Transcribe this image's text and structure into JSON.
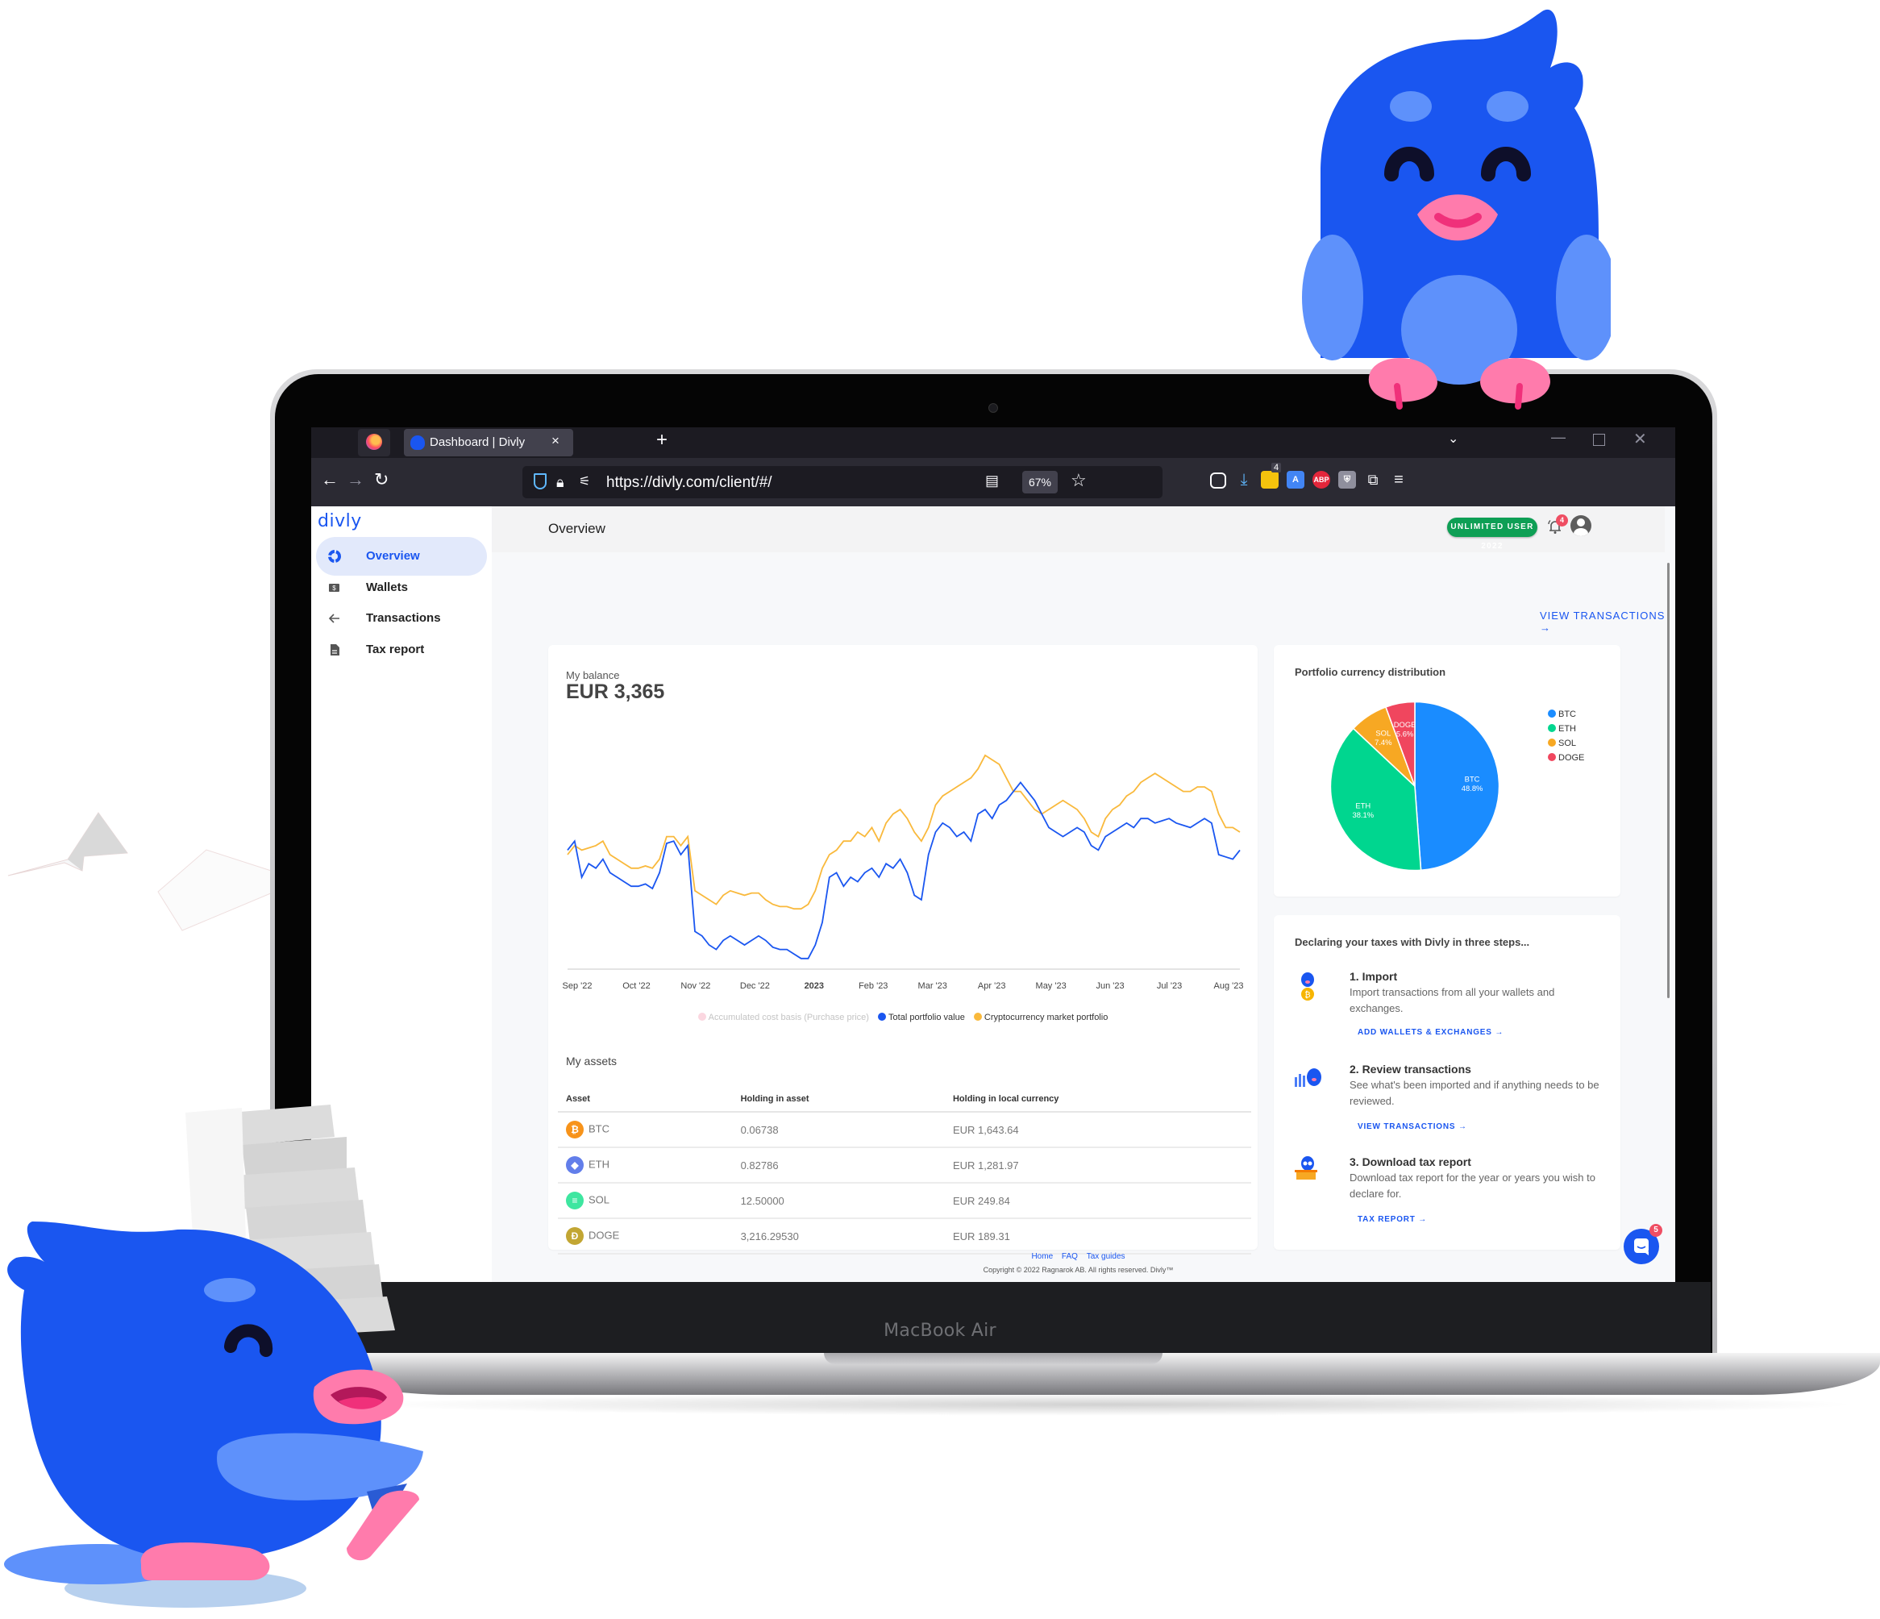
{
  "device": {
    "label": "MacBook Air"
  },
  "browser": {
    "tab_title": "Dashboard | Divly",
    "tab_close": "×",
    "new_tab": "+",
    "list_all_tabs": "⌄",
    "window_controls": {
      "minimize": "—",
      "close": "✕"
    },
    "nav": {
      "back": "←",
      "forward": "→",
      "reload": "↻"
    },
    "url_prefix": "https://",
    "url_domain": "divly.com",
    "url_path": "/client/#/",
    "zoom": "67%",
    "extensions": [
      {
        "name": "pocket",
        "label": "⊙"
      },
      {
        "name": "downloads",
        "label": "⤓"
      },
      {
        "name": "notes-extension",
        "label": "4"
      },
      {
        "name": "translate-extension",
        "label": "A"
      },
      {
        "name": "adblock-plus",
        "label": "ABP"
      },
      {
        "name": "bitwarden",
        "label": "⛨"
      },
      {
        "name": "extensions-puzzle",
        "label": "⧉"
      },
      {
        "name": "menu",
        "label": "≡"
      }
    ],
    "icons": {
      "star": "☆",
      "reader": "▤",
      "lock": "🔒",
      "permissions": "⚟"
    }
  },
  "app": {
    "brand": "divly",
    "sidebar": {
      "items": [
        {
          "label": "Overview",
          "icon": "donut-icon",
          "active": true
        },
        {
          "label": "Wallets",
          "icon": "wallet-icon",
          "active": false
        },
        {
          "label": "Transactions",
          "icon": "arrow-left-icon",
          "active": false
        },
        {
          "label": "Tax report",
          "icon": "document-icon",
          "active": false
        }
      ]
    },
    "header": {
      "title": "Overview",
      "plan_badge": "UNLIMITED USER 2022",
      "notification_count": "4"
    },
    "view_transactions": "VIEW TRANSACTIONS →",
    "balance": {
      "label": "My balance",
      "value": "EUR 3,365"
    },
    "assets": {
      "title": "My assets",
      "columns": [
        "Asset",
        "Holding in asset",
        "Holding in local currency"
      ],
      "rows": [
        {
          "symbol": "BTC",
          "holding": "0.06738",
          "local": "EUR 1,643.64",
          "color": "#f7931a",
          "glyph": "₿"
        },
        {
          "symbol": "ETH",
          "holding": "0.82786",
          "local": "EUR 1,281.97",
          "color": "#627eea",
          "glyph": "◆"
        },
        {
          "symbol": "SOL",
          "holding": "12.50000",
          "local": "EUR 249.84",
          "color": "#3ee6a0",
          "glyph": "≡"
        },
        {
          "symbol": "DOGE",
          "holding": "3,216.29530",
          "local": "EUR 189.31",
          "color": "#c2a633",
          "glyph": "Ð"
        }
      ]
    },
    "pie_title": "Portfolio currency distribution",
    "steps": {
      "title": "Declaring your taxes with Divly in three steps...",
      "items": [
        {
          "heading": "1. Import",
          "desc": "Import transactions from all your wallets and exchanges.",
          "link": "ADD WALLETS & EXCHANGES  →"
        },
        {
          "heading": "2. Review transactions",
          "desc": "See what's been imported and if anything needs to be reviewed.",
          "link": "VIEW TRANSACTIONS  →"
        },
        {
          "heading": "3. Download tax report",
          "desc": "Download tax report for the year or years you wish to declare for.",
          "link": "TAX REPORT  →"
        }
      ]
    },
    "footer": {
      "links": [
        "Home",
        "FAQ",
        "Tax guides"
      ],
      "copyright": "Copyright © 2022 Ragnarok AB. All rights reserved. Divly™"
    },
    "chat_badge": "5",
    "colors": {
      "brand": "#1a56f0",
      "badge_green": "#0e9f55",
      "alert": "#ef4e63"
    }
  },
  "chart_data": [
    {
      "type": "line",
      "title": "My balance",
      "xlabel": "",
      "ylabel": "",
      "x_ticks": [
        "Sep '22",
        "Oct '22",
        "Nov '22",
        "Dec '22",
        "2023",
        "Feb '23",
        "Mar '23",
        "Apr '23",
        "May '23",
        "Jun '23",
        "Jul '23",
        "Aug '23"
      ],
      "grid": false,
      "legend_position": "bottom",
      "legend": [
        {
          "name": "Accumulated cost basis (Purchase price)",
          "color": "#fbd7e0",
          "muted": true
        },
        {
          "name": "Total portfolio value",
          "color": "#1a56f0",
          "muted": false
        },
        {
          "name": "Cryptocurrency market portfolio",
          "color": "#f9b93c",
          "muted": false
        }
      ],
      "ylim": [
        0,
        100
      ],
      "series": [
        {
          "name": "Total portfolio value",
          "color": "#1a56f0",
          "values": [
            52,
            56,
            40,
            46,
            44,
            48,
            42,
            40,
            38,
            36,
            36,
            37,
            35,
            42,
            55,
            56,
            50,
            54,
            16,
            14,
            10,
            8,
            12,
            14,
            12,
            10,
            12,
            14,
            12,
            9,
            8,
            8,
            6,
            4,
            4,
            10,
            20,
            40,
            42,
            36,
            40,
            38,
            42,
            44,
            40,
            46,
            44,
            48,
            42,
            32,
            30,
            50,
            60,
            64,
            62,
            58,
            60,
            56,
            68,
            70,
            66,
            72,
            74,
            78,
            82,
            78,
            74,
            68,
            62,
            60,
            58,
            60,
            62,
            60,
            54,
            52,
            58,
            60,
            62,
            64,
            62,
            66,
            66,
            64,
            65,
            66,
            64,
            63,
            62,
            64,
            66,
            64,
            50,
            49,
            48,
            52
          ]
        },
        {
          "name": "Cryptocurrency market portfolio",
          "color": "#f9b93c",
          "values": [
            50,
            54,
            52,
            53,
            54,
            56,
            50,
            48,
            46,
            44,
            44,
            45,
            44,
            48,
            58,
            58,
            54,
            58,
            34,
            32,
            30,
            28,
            32,
            34,
            33,
            32,
            33,
            33,
            30,
            28,
            27,
            27,
            26,
            26,
            28,
            34,
            44,
            50,
            52,
            56,
            56,
            60,
            58,
            62,
            56,
            64,
            68,
            70,
            66,
            60,
            56,
            62,
            72,
            76,
            78,
            80,
            82,
            84,
            88,
            94,
            92,
            90,
            84,
            78,
            78,
            74,
            70,
            68,
            70,
            72,
            74,
            72,
            70,
            66,
            60,
            58,
            66,
            70,
            72,
            76,
            78,
            82,
            84,
            86,
            84,
            82,
            80,
            78,
            78,
            80,
            80,
            78,
            68,
            62,
            62,
            60
          ]
        }
      ]
    },
    {
      "type": "pie",
      "title": "Portfolio currency distribution",
      "legend_position": "right",
      "labels": [
        "BTC",
        "ETH",
        "SOL",
        "DOGE"
      ],
      "values": [
        48.8,
        38.1,
        7.4,
        5.6
      ],
      "colors": [
        "#1a8cff",
        "#00d68f",
        "#f7a823",
        "#f0465e"
      ]
    }
  ]
}
